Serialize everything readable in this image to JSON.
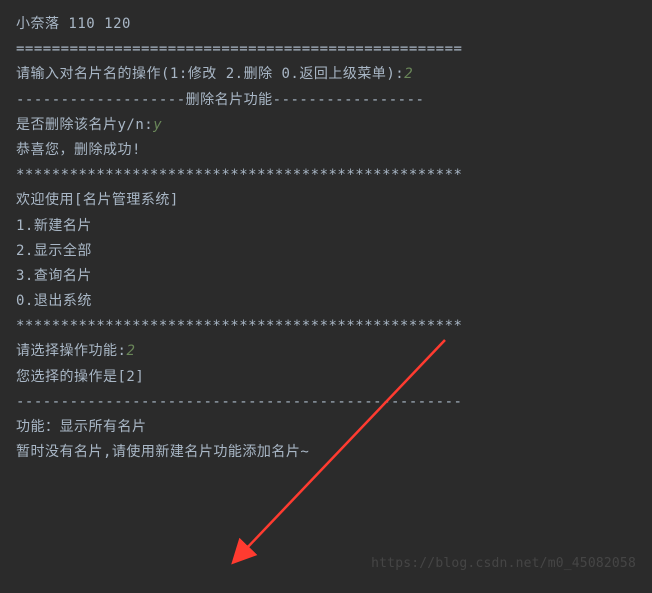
{
  "lines": {
    "l0": "小奈落 110 120",
    "l1": "==================================================",
    "l2_prompt": "请输入对名片名的操作(1:修改 2.删除 0.返回上级菜单):",
    "l2_input": "2",
    "l3": "-------------------删除名片功能-----------------",
    "l4_prompt": "是否删除该名片y/n:",
    "l4_input": "y",
    "l5": "恭喜您，删除成功!",
    "l6": "**************************************************",
    "l7": "欢迎使用[名片管理系统]",
    "l8": "1.新建名片",
    "l9": "2.显示全部",
    "l10": "3.查询名片",
    "l11": "0.退出系统",
    "l12": "**************************************************",
    "l13_prompt": "请选择操作功能:",
    "l13_input": "2",
    "l14": "您选择的操作是[2]",
    "l15": "--------------------------------------------------",
    "l16": "功能：显示所有名片",
    "l17": "暂时没有名片,请使用新建名片功能添加名片~"
  },
  "watermark": "https://blog.csdn.net/m0_45082058",
  "arrow_color": "#ff3b30"
}
